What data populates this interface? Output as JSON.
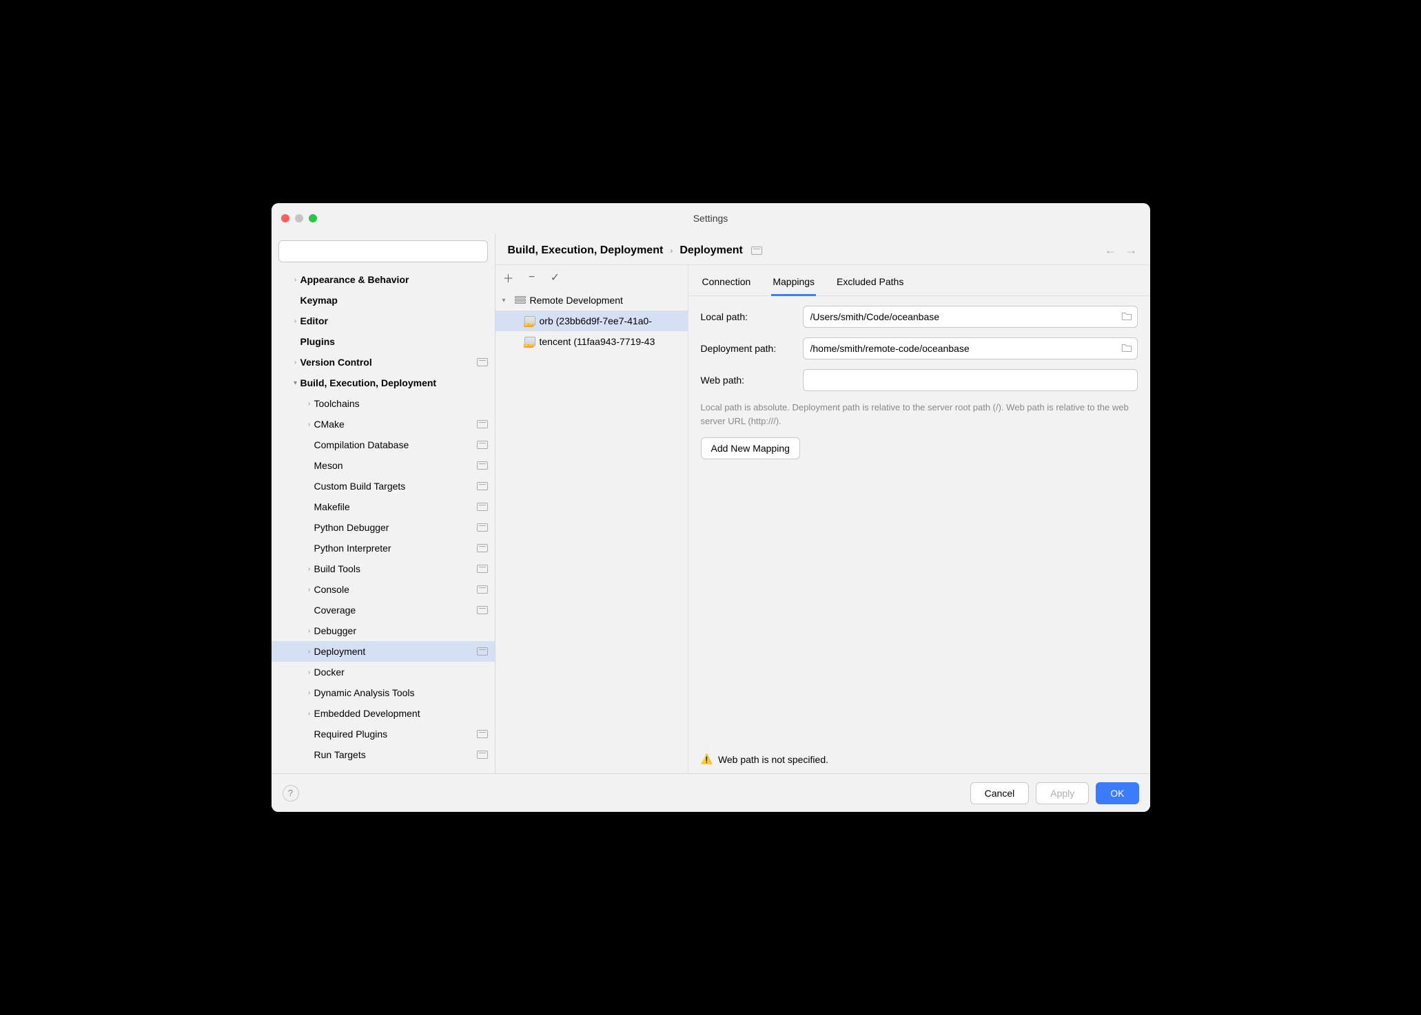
{
  "window": {
    "title": "Settings"
  },
  "breadcrumb": {
    "a": "Build, Execution, Deployment",
    "b": "Deployment"
  },
  "sidebar": {
    "search_placeholder": "",
    "items": [
      {
        "label": "Appearance & Behavior",
        "bold": true,
        "arrow": true,
        "indent": 0,
        "proj": false
      },
      {
        "label": "Keymap",
        "bold": true,
        "arrow": false,
        "indent": 0,
        "proj": false
      },
      {
        "label": "Editor",
        "bold": true,
        "arrow": true,
        "indent": 0,
        "proj": false
      },
      {
        "label": "Plugins",
        "bold": true,
        "arrow": false,
        "indent": 0,
        "proj": false
      },
      {
        "label": "Version Control",
        "bold": true,
        "arrow": true,
        "indent": 0,
        "proj": true
      },
      {
        "label": "Build, Execution, Deployment",
        "bold": true,
        "arrow": true,
        "arrowdown": true,
        "indent": 0,
        "proj": false
      },
      {
        "label": "Toolchains",
        "bold": false,
        "arrow": true,
        "indent": 1,
        "proj": false
      },
      {
        "label": "CMake",
        "bold": false,
        "arrow": true,
        "indent": 1,
        "proj": true
      },
      {
        "label": "Compilation Database",
        "bold": false,
        "arrow": false,
        "indent": 1,
        "proj": true
      },
      {
        "label": "Meson",
        "bold": false,
        "arrow": false,
        "indent": 1,
        "proj": true
      },
      {
        "label": "Custom Build Targets",
        "bold": false,
        "arrow": false,
        "indent": 1,
        "proj": true
      },
      {
        "label": "Makefile",
        "bold": false,
        "arrow": false,
        "indent": 1,
        "proj": true
      },
      {
        "label": "Python Debugger",
        "bold": false,
        "arrow": false,
        "indent": 1,
        "proj": true
      },
      {
        "label": "Python Interpreter",
        "bold": false,
        "arrow": false,
        "indent": 1,
        "proj": true
      },
      {
        "label": "Build Tools",
        "bold": false,
        "arrow": true,
        "indent": 1,
        "proj": true
      },
      {
        "label": "Console",
        "bold": false,
        "arrow": true,
        "indent": 1,
        "proj": true
      },
      {
        "label": "Coverage",
        "bold": false,
        "arrow": false,
        "indent": 1,
        "proj": true
      },
      {
        "label": "Debugger",
        "bold": false,
        "arrow": true,
        "indent": 1,
        "proj": false
      },
      {
        "label": "Deployment",
        "bold": false,
        "arrow": true,
        "indent": 1,
        "proj": true,
        "selected": true
      },
      {
        "label": "Docker",
        "bold": false,
        "arrow": true,
        "indent": 1,
        "proj": false
      },
      {
        "label": "Dynamic Analysis Tools",
        "bold": false,
        "arrow": true,
        "indent": 1,
        "proj": false
      },
      {
        "label": "Embedded Development",
        "bold": false,
        "arrow": true,
        "indent": 1,
        "proj": false
      },
      {
        "label": "Required Plugins",
        "bold": false,
        "arrow": false,
        "indent": 1,
        "proj": true
      },
      {
        "label": "Run Targets",
        "bold": false,
        "arrow": false,
        "indent": 1,
        "proj": true
      }
    ]
  },
  "servers": {
    "group": "Remote Development",
    "items": [
      {
        "label": "orb (23bb6d9f-7ee7-41a0-",
        "selected": true
      },
      {
        "label": "tencent (11faa943-7719-43",
        "selected": false
      }
    ]
  },
  "tabs": {
    "a": "Connection",
    "b": "Mappings",
    "c": "Excluded Paths"
  },
  "form": {
    "local_label": "Local path:",
    "local_value": "/Users/smith/Code/oceanbase",
    "deploy_label": "Deployment path:",
    "deploy_value": "/home/smith/remote-code/oceanbase",
    "web_label": "Web path:",
    "web_value": "",
    "hint": "Local path is absolute. Deployment path is relative to the server root path (/). Web path is relative to the web server URL (http:///).",
    "add_button": "Add New Mapping"
  },
  "warning": "Web path is not specified.",
  "footer": {
    "cancel": "Cancel",
    "apply": "Apply",
    "ok": "OK"
  }
}
